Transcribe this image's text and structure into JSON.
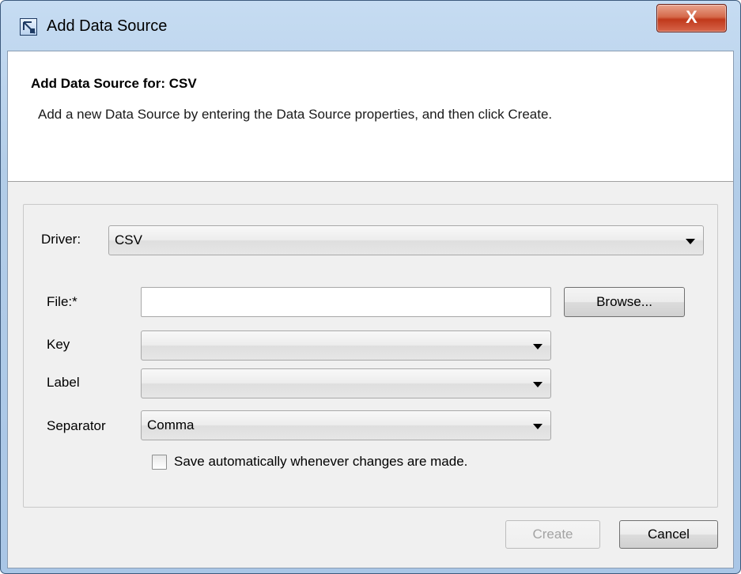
{
  "window": {
    "title": "Add Data Source",
    "close_label": "X"
  },
  "header": {
    "title": "Add Data Source for: CSV",
    "description": "Add a new Data Source by entering the Data Source properties, and then click Create."
  },
  "form": {
    "driver": {
      "label": "Driver:",
      "value": "CSV"
    },
    "file": {
      "label": "File:*",
      "value": "",
      "browse_label": "Browse..."
    },
    "key": {
      "label": "Key",
      "value": ""
    },
    "label_field": {
      "label": "Label",
      "value": ""
    },
    "separator": {
      "label": "Separator",
      "value": "Comma"
    },
    "autosave": {
      "label": "Save automatically whenever changes are made.",
      "checked": false
    }
  },
  "buttons": {
    "create_label": "Create",
    "cancel_label": "Cancel"
  },
  "icons": {
    "app": "diagram-app-icon",
    "close": "close-icon",
    "dropdown": "chevron-down-icon"
  },
  "colors": {
    "title_bar": "#c6dcf2",
    "close_button": "#c0391b",
    "dialog_background": "#f0f0f0"
  }
}
